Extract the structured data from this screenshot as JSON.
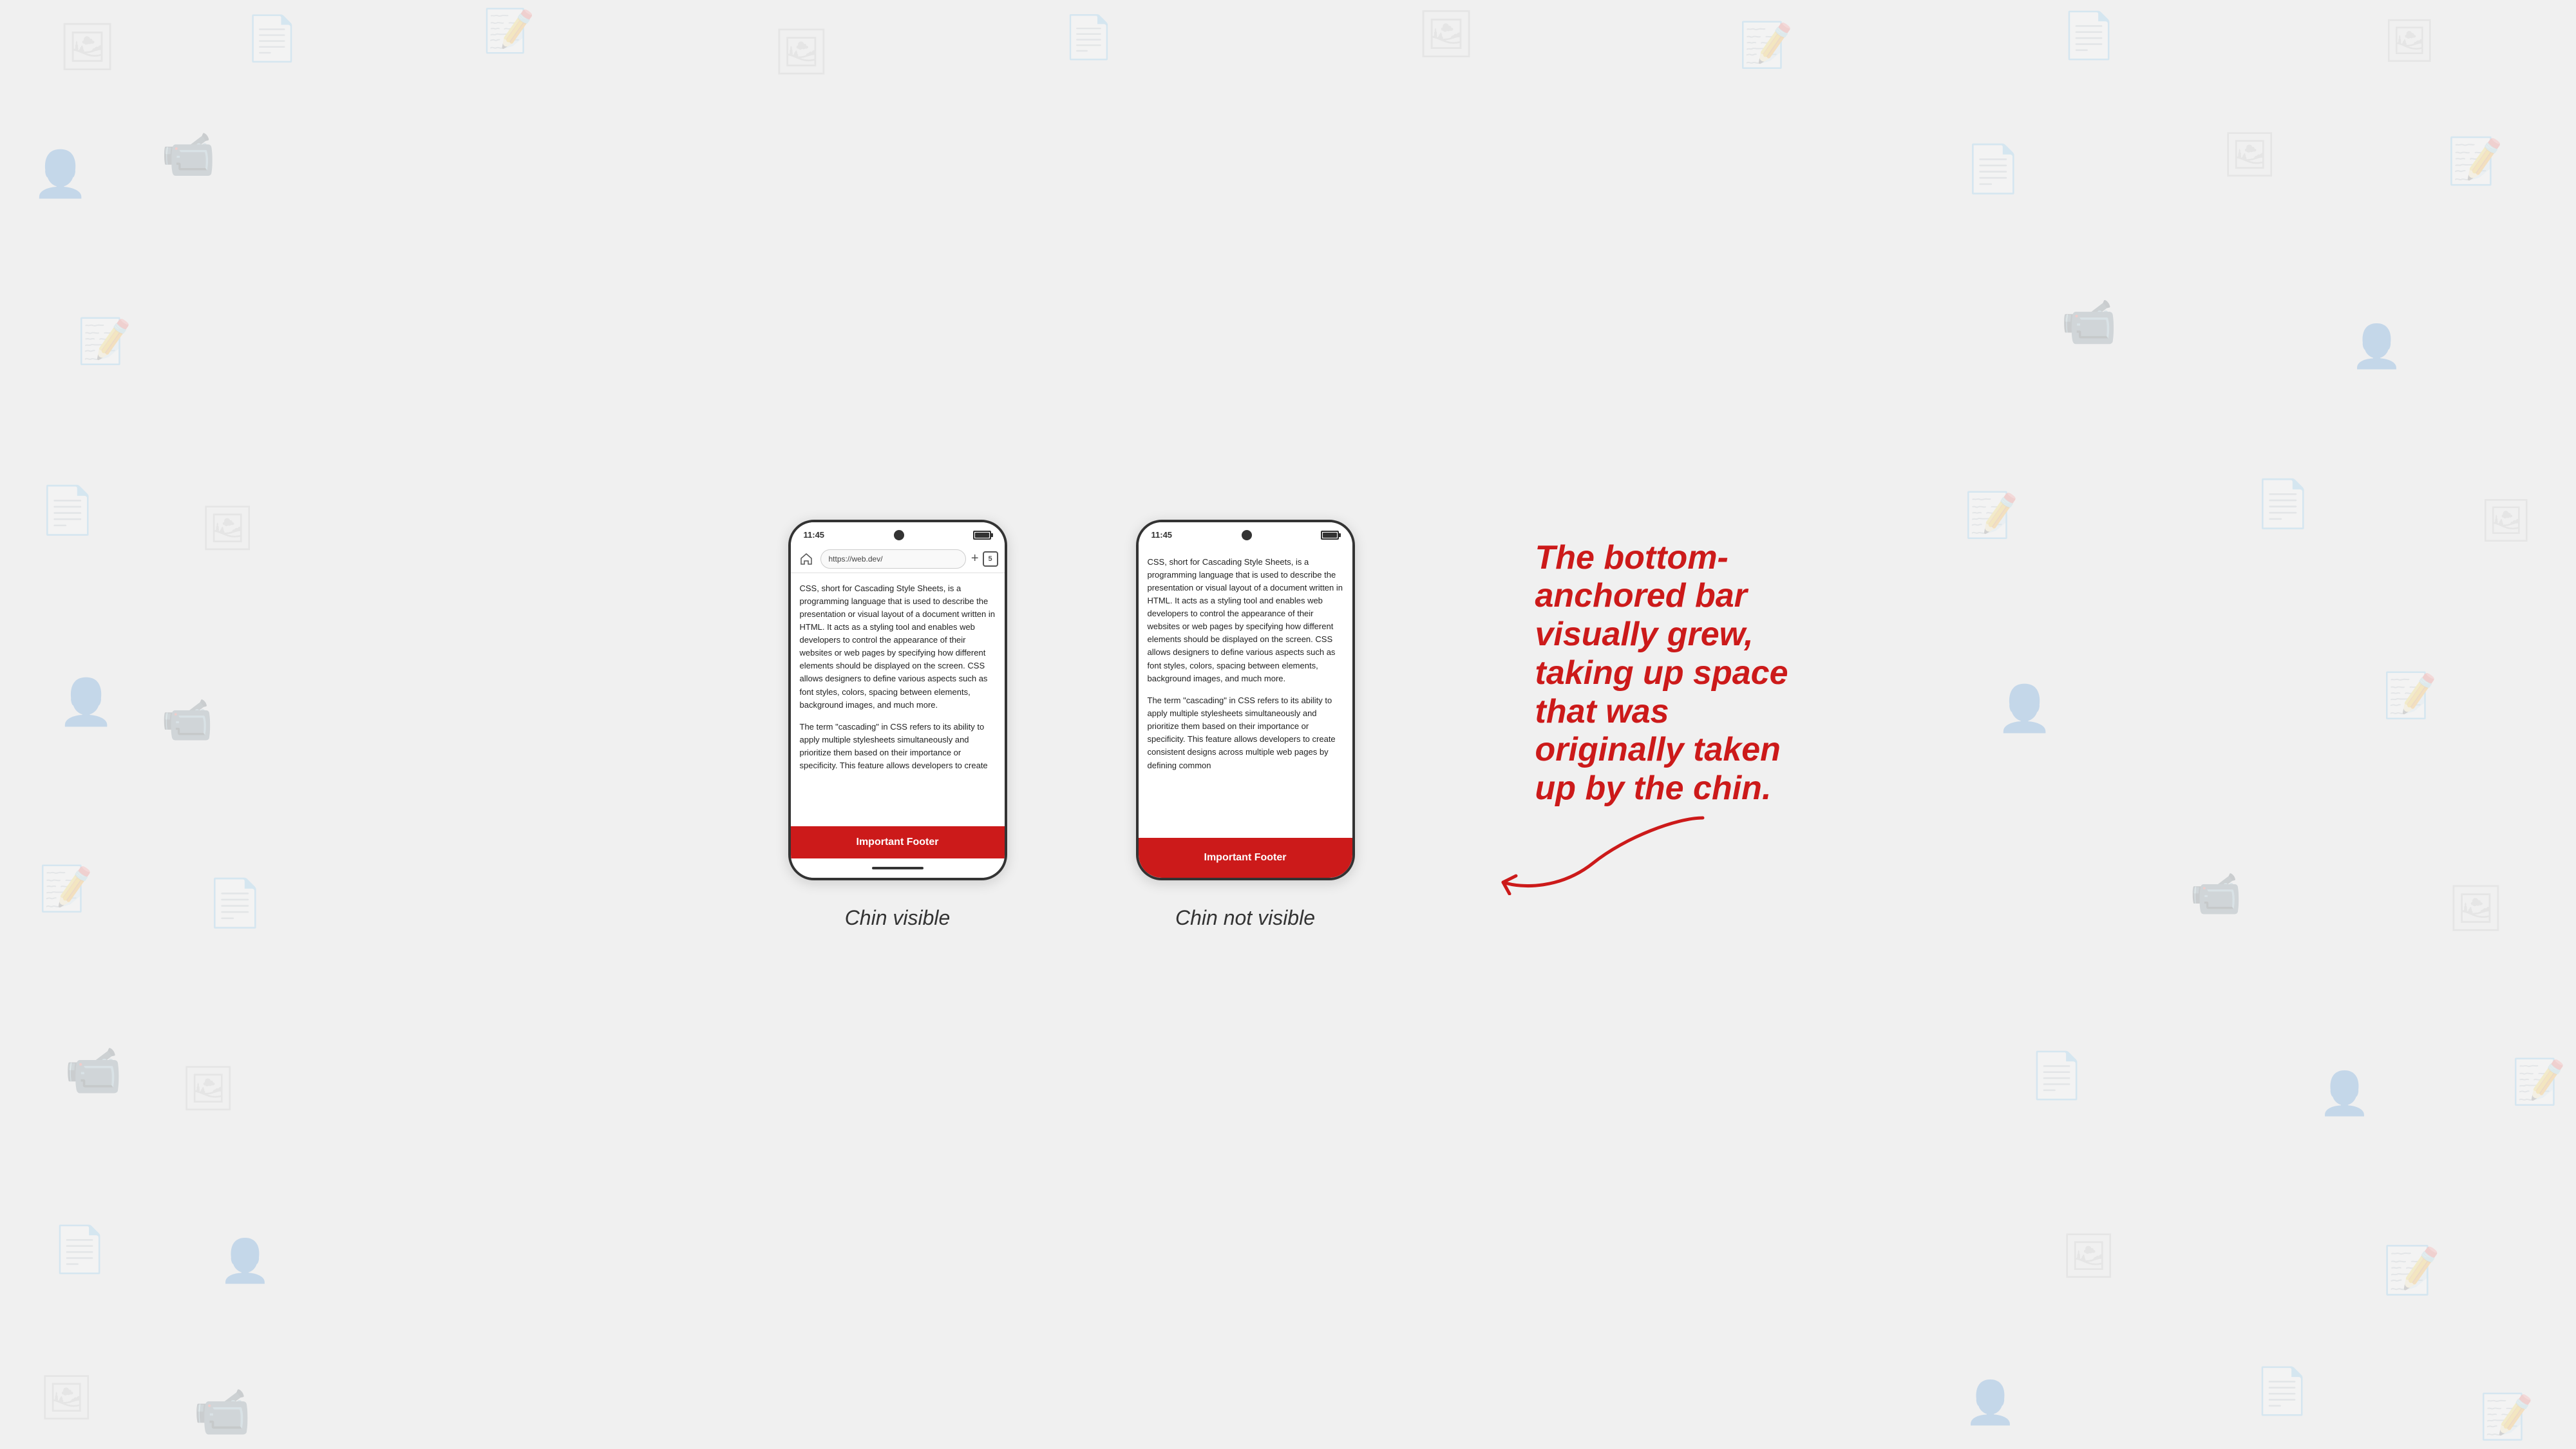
{
  "background": {
    "color": "#f0f0f0"
  },
  "phone1": {
    "status_time": "11:45",
    "url": "https://web.dev/",
    "tab_count": "5",
    "content_paragraphs": [
      "CSS, short for Cascading Style Sheets, is a programming language that is used to describe the presentation or visual layout of a document written in HTML. It acts as a styling tool and enables web developers to control the appearance of their websites or web pages by specifying how different elements should be displayed on the screen. CSS allows designers to define various aspects such as font styles, colors, spacing between elements, background images, and much more.",
      "The term \"cascading\" in CSS refers to its ability to apply multiple stylesheets simultaneously and prioritize them based on their importance or specificity. This feature allows developers to create"
    ],
    "footer_label": "Important Footer",
    "caption": "Chin visible",
    "has_chin": true,
    "has_browser_bar": true
  },
  "phone2": {
    "status_time": "11:45",
    "content_paragraphs": [
      "CSS, short for Cascading Style Sheets, is a programming language that is used to describe the presentation or visual layout of a document written in HTML. It acts as a styling tool and enables web developers to control the appearance of their websites or web pages by specifying how different elements should be displayed on the screen. CSS allows designers to define various aspects such as font styles, colors, spacing between elements, background images, and much more.",
      "The term \"cascading\" in CSS refers to its ability to apply multiple stylesheets simultaneously and prioritize them based on their importance or specificity. This feature allows developers to create consistent designs across multiple web pages by defining common"
    ],
    "footer_label": "Important Footer",
    "caption": "Chin not visible",
    "has_chin": false,
    "has_browser_bar": false
  },
  "annotation": {
    "line1": "The bottom-",
    "line2": "anchored bar",
    "line3": "visually grew,",
    "line4": "taking up space",
    "line5": "that was",
    "line6": "originally taken",
    "line7": "up by the chin."
  }
}
